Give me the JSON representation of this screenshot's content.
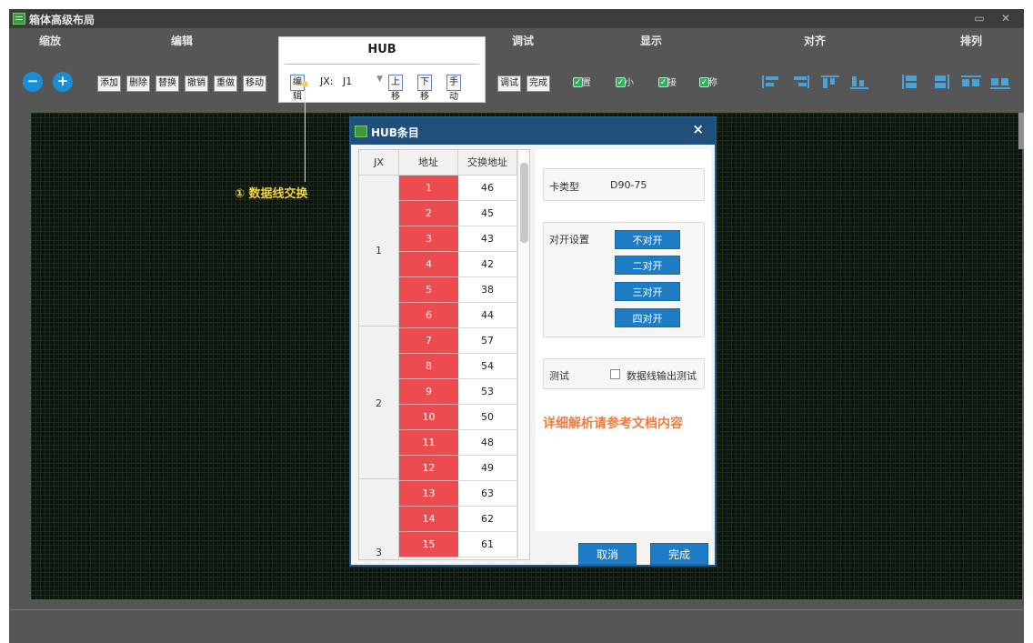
{
  "window": {
    "title": "箱体高级布局",
    "maximize_glyph": "▭",
    "close_glyph": "✕"
  },
  "groups": {
    "zoom": "缩放",
    "edit": "编辑",
    "debug": "调试",
    "display": "显示",
    "align": "对齐",
    "arrange": "排列"
  },
  "zoom_buttons": {
    "zoom_out": "−",
    "zoom_in": "+"
  },
  "edit_buttons": [
    "添加",
    "删除",
    "替换",
    "撤销",
    "重做",
    "移动"
  ],
  "hub": {
    "title": "HUB",
    "edit": "编辑",
    "jx_label": "JX:",
    "jx_value": "J1",
    "select_arrow": "▼",
    "move_up": "上移",
    "move_down": "下移",
    "manual": "手动"
  },
  "debug_buttons": [
    "调试",
    "完成"
  ],
  "display_checks": [
    "位置",
    "大小",
    "连接",
    "名称"
  ],
  "check_glyph": "✓",
  "callout": "① 数据线交换",
  "dialog": {
    "title": "HUB条目",
    "close": "×",
    "columns": [
      "JX",
      "地址",
      "交换地址"
    ],
    "groups": [
      "1",
      "2",
      "3"
    ],
    "rows": [
      [
        "1",
        "46"
      ],
      [
        "2",
        "45"
      ],
      [
        "3",
        "43"
      ],
      [
        "4",
        "42"
      ],
      [
        "5",
        "38"
      ],
      [
        "6",
        "44"
      ],
      [
        "7",
        "57"
      ],
      [
        "8",
        "54"
      ],
      [
        "9",
        "53"
      ],
      [
        "10",
        "50"
      ],
      [
        "11",
        "48"
      ],
      [
        "12",
        "49"
      ],
      [
        "13",
        "63"
      ],
      [
        "14",
        "62"
      ],
      [
        "15",
        "61"
      ]
    ],
    "card_type_label": "卡类型",
    "card_type_value": "D90-75",
    "split_label": "对开设置",
    "split_options": [
      "不对开",
      "二对开",
      "三对开",
      "四对开"
    ],
    "test_label": "测试",
    "test_check": "数据线输出测试",
    "note": "详细解析请参考文档内容",
    "cancel": "取消",
    "done": "完成"
  }
}
